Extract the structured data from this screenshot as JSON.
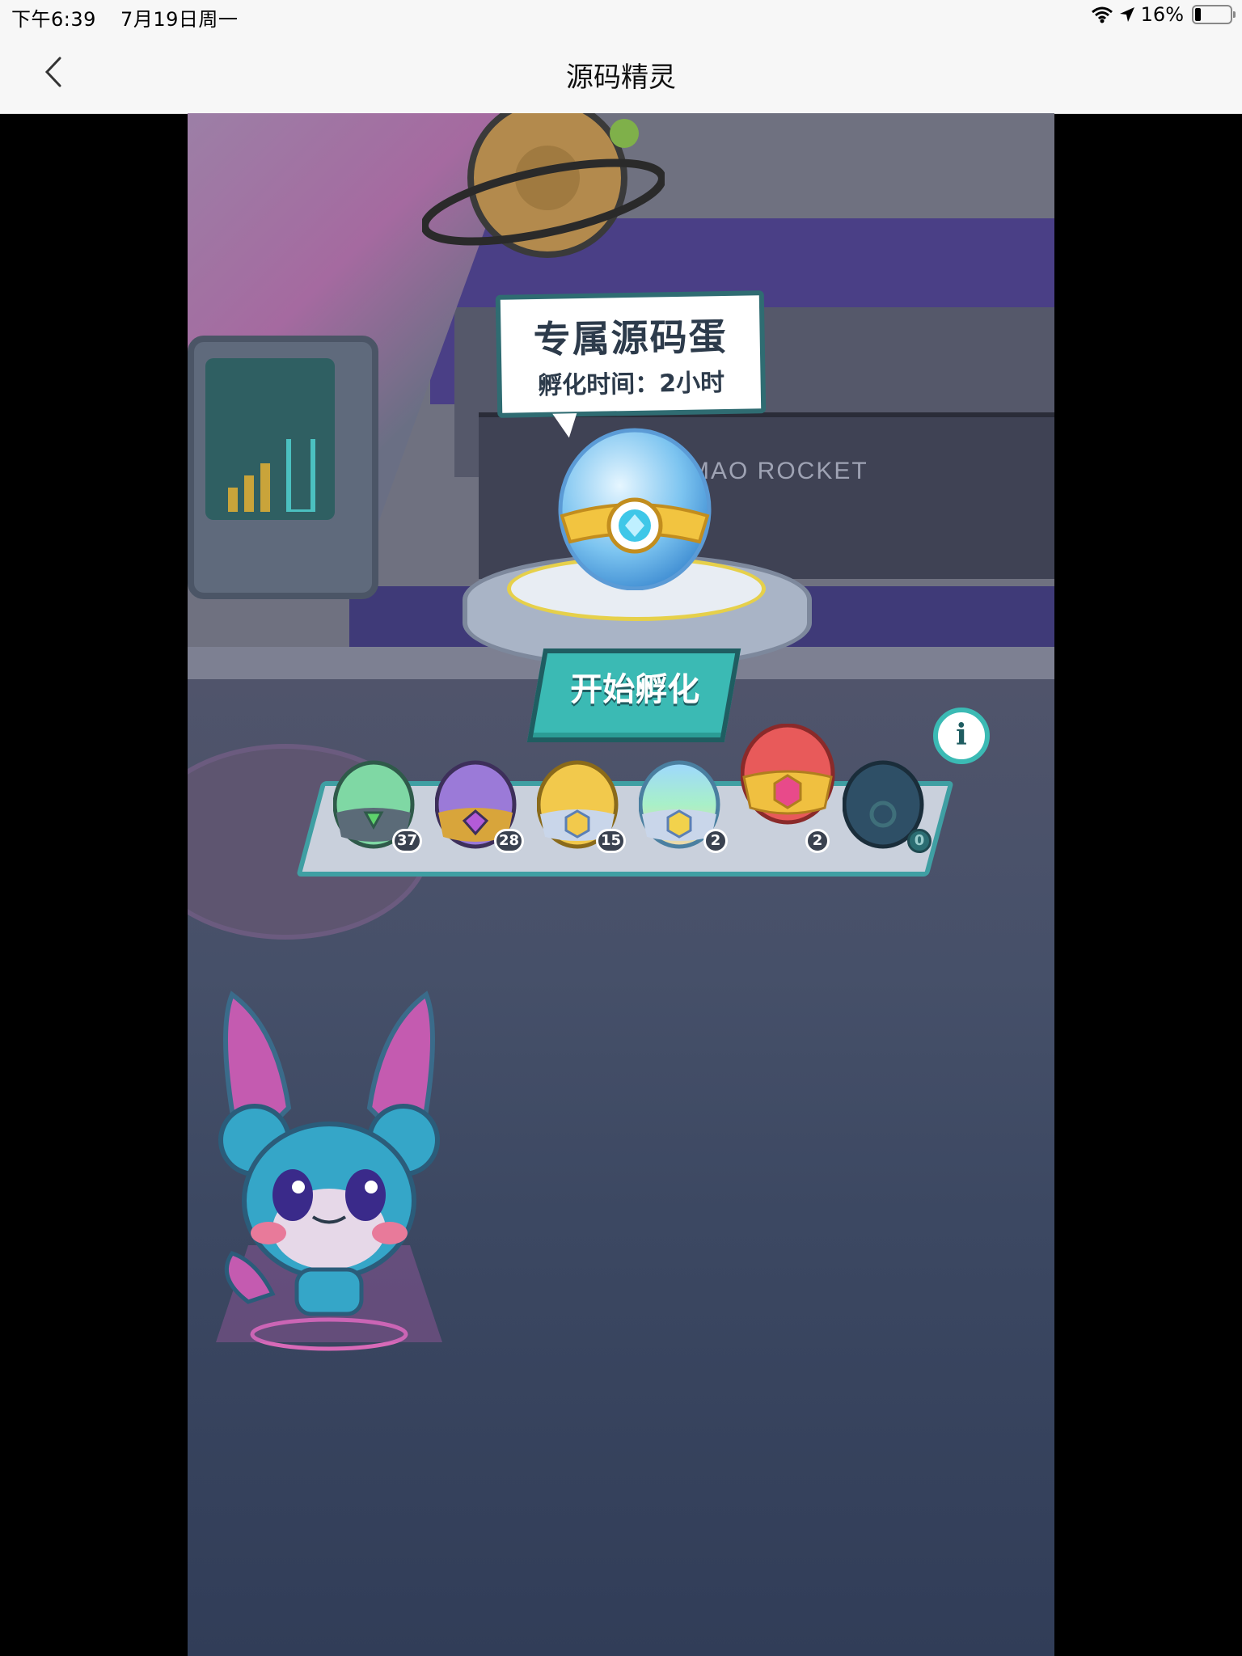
{
  "status_bar": {
    "time": "下午6:39",
    "date": "7月19日周一",
    "battery_percent": "16%",
    "battery_level": 0.16,
    "icons": [
      "wifi-icon",
      "location-arrow-icon",
      "battery-icon"
    ]
  },
  "nav": {
    "title": "源码精灵",
    "back_icon": "chevron-left-icon"
  },
  "scene": {
    "wall_sign": "MAO ROCKET"
  },
  "hatchery": {
    "egg_name": "专属源码蛋",
    "hatch_time": "孵化时间：2小时",
    "start_button": "开始孵化",
    "info_icon": "i"
  },
  "eggs": [
    {
      "type": "green-egg",
      "count": "37",
      "color": "#7fd8a4"
    },
    {
      "type": "purple-egg",
      "count": "28",
      "color": "#9b7ad8"
    },
    {
      "type": "gold-egg",
      "count": "15",
      "color": "#f2c94c"
    },
    {
      "type": "rainbow-egg",
      "count": "2",
      "color": "#8fd8e8"
    },
    {
      "type": "red-egg",
      "count": "2",
      "color": "#e85a5a"
    },
    {
      "type": "dark-egg",
      "count": "0",
      "color": "#2e4f66"
    }
  ]
}
